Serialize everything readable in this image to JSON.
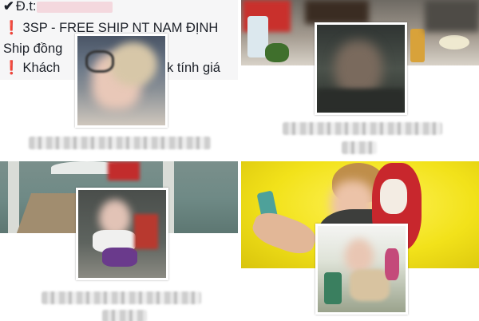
{
  "post": {
    "line1_prefix": "Đ.t:",
    "line2": "3SP - FREE SHIP NT NAM ĐỊNH",
    "line3": "Ship đồng",
    "line4_start": "Khách",
    "line4_end": "k tính giá"
  },
  "icons": {
    "check": "✔",
    "exclamation": "❗"
  },
  "colors": {
    "accent_red": "#d0021b",
    "yellow_bg": "#f2e21a",
    "lake": "#6f8a86"
  }
}
